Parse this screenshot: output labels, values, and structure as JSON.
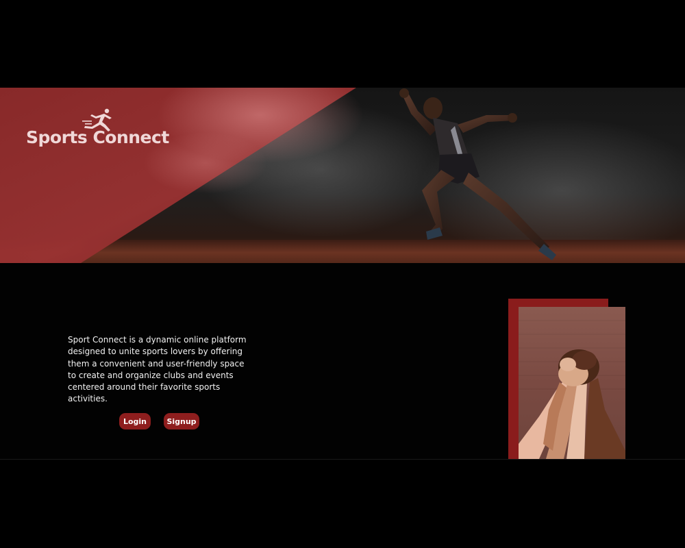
{
  "brand": {
    "name": "Sports Connect",
    "icon": "runner-icon"
  },
  "hero": {
    "accent_color": "#8e1e1e"
  },
  "about": {
    "description": "Sport Connect is a dynamic online platform designed to unite sports lovers by offering them a convenient and user-friendly space to create and organize clubs and events centered around their favorite sports activities."
  },
  "actions": {
    "login_label": "Login",
    "signup_label": "Signup"
  },
  "colors": {
    "background": "#000000",
    "accent": "#8e1e1e",
    "text": "#f2f2f2"
  }
}
